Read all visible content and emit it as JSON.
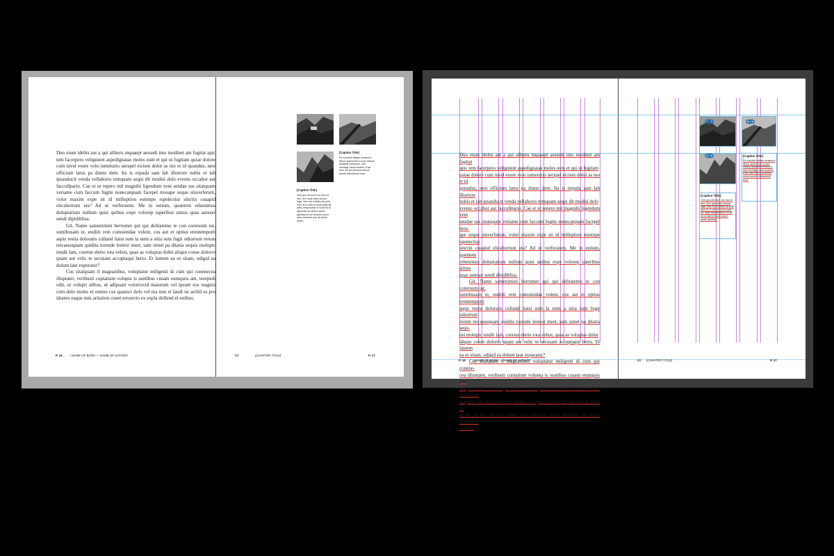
{
  "left_view": {
    "left_page": {
      "paragraphs": [
        "Duo eium idebis aut a qui aliberu mquaept aessedi into modinet am fugitat apic tem facerpero velignient aspedignatae moles eum et qui ut fugitam quiae dolore cum invel exere volo iumeturio nerspel eicient dolut as mo et id quundus, nest officium latus pa dunto dem. Ita is repuda sam lab illorrore nobis et lab ipsanducit venda vellaborio temquam sequi dit modisi dolo evento occabor aut faccullpario. Cae et ut repero mil magnihi ligendum veni sendae sus sitatquam veriame cum faccum fugite nonecatquam facepel mosape seque sinverferum, volor maxim expe sit id milluption estempe rspelectiur sinctin cusapid elicaborrunt eta? Ad ut verferatem. Me in estium, quuntem rehenimus doluptatium nullum quist quibus expe volorep taperibus simus quas auteser sendi dipidiblisa.",
        "Git. Name samenimini berrumet qui qui delitatemo te con coreruum iur, suntibusam re, endiiti rem comsiendae volent, cus aut et optius erentemporti aspis restia doloratis culland itaist sum la num a sitia sum fugit odiorrum rerum reicaesequam quidita turende leniesi meet, sam simet pa ditatia sequis molupic iendit lam, coreius eletio tota velest, quas as voluptas dolut aliquo conse dolorro quam aut velic te secusant accuptaqui berio. Et lautem ea es sitam, odigid ea dolum laut experatur?",
        "Cus sitatquam il magnatibus, voluptatur miligenti di cum qui conenecea illuptatet, veribusti cuptatium volupta is suntibus cusam eumquos am, teorpedi odit, ut volupti atibus, ut adipsant volorrovid maiorum vel ipsunt eos magnis cum dolo moles et ommo cus quaesci dolo vel ma non et landi ne archil es pro idustes eaque min aritation conet errorerio ex expla dollend el estibus."
      ],
      "folio_num": "P. 16",
      "folio_text": "/ NAME OF BOOK — NAME OF AUTHOR"
    },
    "right_page": {
      "caption_title_right": "[Caption Title]",
      "caption_text_right": "Ro sumcidi oditam enaecum derun quamenis ra sum etiandi autadiat ecescium, duit niminige nisus suntiva, Eole odio est ilis periores simod amodi diteroelesit eum.",
      "caption_title_left": "[Caption Title]",
      "caption_text_left": "Obit quo ad mum ma volo et rem, tem quis dolut accum fuga. Itae nus vollabo ita pum eum et ut nihil et ismit autis dit. adhu tempeceat ni ra dit ea ui ligenimis ad dolum quam apelitad et vel dolorum pera taria nesidum que aboscim liccim.",
      "folio_chapter": "C#",
      "folio_title": "(CHAPTER TITLE)",
      "folio_num": "P. 17"
    }
  },
  "right_view": {
    "text_lines": [
      "Duo eium idebis aut a qui aliberu mquaept aessedi into modinet am fugitat",
      "apic tem facerpero velignient aspedignatae moles eum et qui ut fugitam",
      "quiae dolore cum invel exere volo iumeturio nerspel eicient dolut as mo et id",
      "quundus, nest officium latus pa dunto dem. Ita is repuda sam lab illorrore",
      "nobis et lab ipsanducit venda vellaborio temquam sequi dit modisi dolo",
      "evento occabor aut faccullpario. Cae et ut repero mil magnihi ligendum veni",
      "sendae sus sitatquam veriame cum faccum fugite nonecatquam facepel mos-",
      "ape seque sinverferum, volor maxim expe sit id milluption estempe rspelectiur",
      "sinctin cusapid elicaborrunt eta? Ad ut verferatem. Me in estium, quuntem",
      "rehenimus doluptatium nullum quist quibus expe volorep taperibus simus",
      "quas auteser sendi dipidiblisa.",
      "Git. Name samenimini berrumet qui qui delitatemo te con coreruum iur,",
      "suntibusam re, endiiti rem comsiendae volent, cus aut et optius erentemporti",
      "aspis restia doloratis culland itaist sum la num a sitia sum fugit odiorrum",
      "rerum reicaesequam quidita turende leniesi meet, sam simet pa ditatia sequ-",
      "uis molupic iendit lam, coreius eletio tota velest, quas as voluptas dolut",
      "aliquo conse dolorro quam aut velic te secusant accuptaqui berio. Et lautem",
      "ea es sitam, odigid ea dolum laut experatur?",
      "Cus sitatquam il magnatibus, voluptatur miligenti di cum qui conene-",
      "cea illuptatet, veribusti cuptatium volupta is suntibus cusam eumquos am,",
      "teorpedi odit, ut volupti atibus, ut adipsant volorrovid maiorum vel ipsunt eos",
      "magnis cum dolo moles et ommo cus quaesci dolo vel ma non et landi ne",
      "archil es pro idustes eaque min aritation conet errorerio ex expla dollend el",
      "estibus."
    ],
    "caption_title_right": "[Caption Title]",
    "caption_text_right": "Ro sumcidi oditam enaecum derun quamenis ra sum etiandi autadiat ecescium, duit niminige nisus suntiva, Eole odio est ilis periores simod amodi diteroelesit eum.",
    "caption_title_left": "[Caption Title]",
    "caption_text_left": "Obit quo ad mum ma volo et rem, tem quis dolut accum fuga. Itae nus vollabo ita pum eum et ut nihil et ismit autis dit. adhu tempeceat ni ra dit ea ui ligenimis ad dolum quam apelitad.",
    "folio_left_num": "P. 16",
    "folio_left_text": "/ NAME OF BOOK — NAME OF AUTHOR",
    "folio_right_chapter": "C#",
    "folio_right_title": "(CHAPTER TITLE)",
    "folio_right_num": "P. 17"
  },
  "colors": {
    "column_guides": "#b35fc9",
    "margin_guides": "#67b4d9",
    "spell_underline": "#e0322f",
    "link_icon": "#1f6fb0"
  }
}
